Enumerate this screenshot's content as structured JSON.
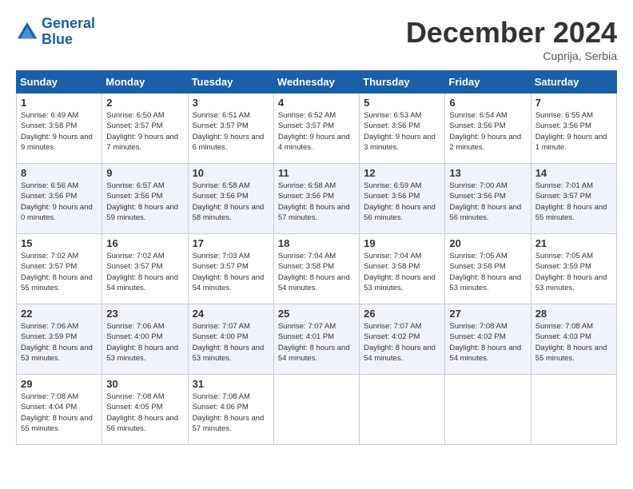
{
  "header": {
    "logo_line1": "General",
    "logo_line2": "Blue",
    "month_title": "December 2024",
    "location": "Cuprija, Serbia"
  },
  "weekdays": [
    "Sunday",
    "Monday",
    "Tuesday",
    "Wednesday",
    "Thursday",
    "Friday",
    "Saturday"
  ],
  "weeks": [
    [
      {
        "day": "1",
        "sunrise": "6:49 AM",
        "sunset": "3:58 PM",
        "daylight": "9 hours and 9 minutes."
      },
      {
        "day": "2",
        "sunrise": "6:50 AM",
        "sunset": "3:57 PM",
        "daylight": "9 hours and 7 minutes."
      },
      {
        "day": "3",
        "sunrise": "6:51 AM",
        "sunset": "3:57 PM",
        "daylight": "9 hours and 6 minutes."
      },
      {
        "day": "4",
        "sunrise": "6:52 AM",
        "sunset": "3:57 PM",
        "daylight": "9 hours and 4 minutes."
      },
      {
        "day": "5",
        "sunrise": "6:53 AM",
        "sunset": "3:56 PM",
        "daylight": "9 hours and 3 minutes."
      },
      {
        "day": "6",
        "sunrise": "6:54 AM",
        "sunset": "3:56 PM",
        "daylight": "9 hours and 2 minutes."
      },
      {
        "day": "7",
        "sunrise": "6:55 AM",
        "sunset": "3:56 PM",
        "daylight": "9 hours and 1 minute."
      }
    ],
    [
      {
        "day": "8",
        "sunrise": "6:56 AM",
        "sunset": "3:56 PM",
        "daylight": "9 hours and 0 minutes."
      },
      {
        "day": "9",
        "sunrise": "6:57 AM",
        "sunset": "3:56 PM",
        "daylight": "8 hours and 59 minutes."
      },
      {
        "day": "10",
        "sunrise": "6:58 AM",
        "sunset": "3:56 PM",
        "daylight": "8 hours and 58 minutes."
      },
      {
        "day": "11",
        "sunrise": "6:58 AM",
        "sunset": "3:56 PM",
        "daylight": "8 hours and 57 minutes."
      },
      {
        "day": "12",
        "sunrise": "6:59 AM",
        "sunset": "3:56 PM",
        "daylight": "8 hours and 56 minutes."
      },
      {
        "day": "13",
        "sunrise": "7:00 AM",
        "sunset": "3:56 PM",
        "daylight": "8 hours and 56 minutes."
      },
      {
        "day": "14",
        "sunrise": "7:01 AM",
        "sunset": "3:57 PM",
        "daylight": "8 hours and 55 minutes."
      }
    ],
    [
      {
        "day": "15",
        "sunrise": "7:02 AM",
        "sunset": "3:57 PM",
        "daylight": "8 hours and 55 minutes."
      },
      {
        "day": "16",
        "sunrise": "7:02 AM",
        "sunset": "3:57 PM",
        "daylight": "8 hours and 54 minutes."
      },
      {
        "day": "17",
        "sunrise": "7:03 AM",
        "sunset": "3:57 PM",
        "daylight": "8 hours and 54 minutes."
      },
      {
        "day": "18",
        "sunrise": "7:04 AM",
        "sunset": "3:58 PM",
        "daylight": "8 hours and 54 minutes."
      },
      {
        "day": "19",
        "sunrise": "7:04 AM",
        "sunset": "3:58 PM",
        "daylight": "8 hours and 53 minutes."
      },
      {
        "day": "20",
        "sunrise": "7:05 AM",
        "sunset": "3:58 PM",
        "daylight": "8 hours and 53 minutes."
      },
      {
        "day": "21",
        "sunrise": "7:05 AM",
        "sunset": "3:59 PM",
        "daylight": "8 hours and 53 minutes."
      }
    ],
    [
      {
        "day": "22",
        "sunrise": "7:06 AM",
        "sunset": "3:59 PM",
        "daylight": "8 hours and 53 minutes."
      },
      {
        "day": "23",
        "sunrise": "7:06 AM",
        "sunset": "4:00 PM",
        "daylight": "8 hours and 53 minutes."
      },
      {
        "day": "24",
        "sunrise": "7:07 AM",
        "sunset": "4:00 PM",
        "daylight": "8 hours and 53 minutes."
      },
      {
        "day": "25",
        "sunrise": "7:07 AM",
        "sunset": "4:01 PM",
        "daylight": "8 hours and 54 minutes."
      },
      {
        "day": "26",
        "sunrise": "7:07 AM",
        "sunset": "4:02 PM",
        "daylight": "8 hours and 54 minutes."
      },
      {
        "day": "27",
        "sunrise": "7:08 AM",
        "sunset": "4:02 PM",
        "daylight": "8 hours and 54 minutes."
      },
      {
        "day": "28",
        "sunrise": "7:08 AM",
        "sunset": "4:03 PM",
        "daylight": "8 hours and 55 minutes."
      }
    ],
    [
      {
        "day": "29",
        "sunrise": "7:08 AM",
        "sunset": "4:04 PM",
        "daylight": "8 hours and 55 minutes."
      },
      {
        "day": "30",
        "sunrise": "7:08 AM",
        "sunset": "4:05 PM",
        "daylight": "8 hours and 56 minutes."
      },
      {
        "day": "31",
        "sunrise": "7:08 AM",
        "sunset": "4:06 PM",
        "daylight": "8 hours and 57 minutes."
      },
      null,
      null,
      null,
      null
    ]
  ]
}
